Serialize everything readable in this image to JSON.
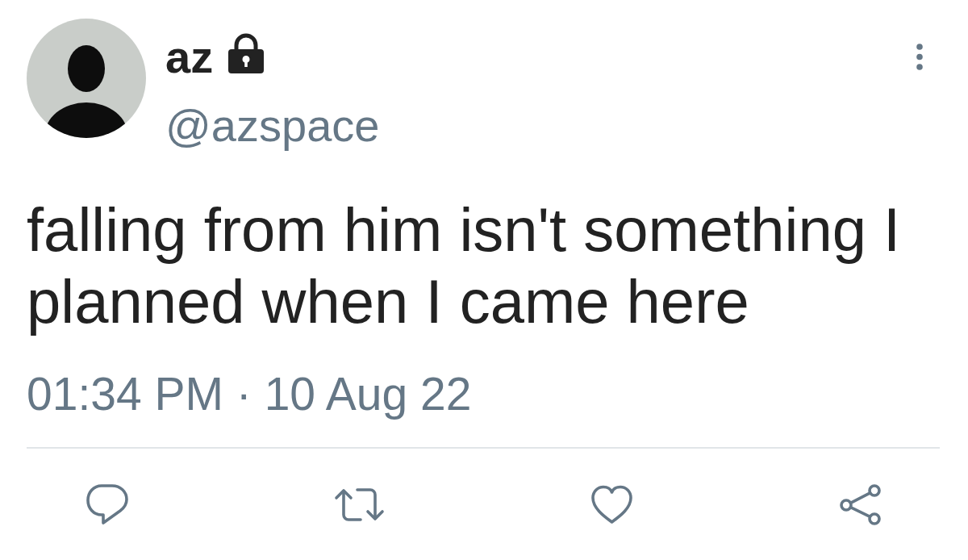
{
  "tweet": {
    "author": {
      "name": "az",
      "protected": true,
      "handle": "@azspace"
    },
    "text": "falling from him isn't something I planned when I came here",
    "timestamp": "01:34 PM · 10 Aug 22",
    "actions": [
      {
        "kind": "reply"
      },
      {
        "kind": "retweet"
      },
      {
        "kind": "like",
        "selected": false
      },
      {
        "kind": "share"
      }
    ]
  }
}
